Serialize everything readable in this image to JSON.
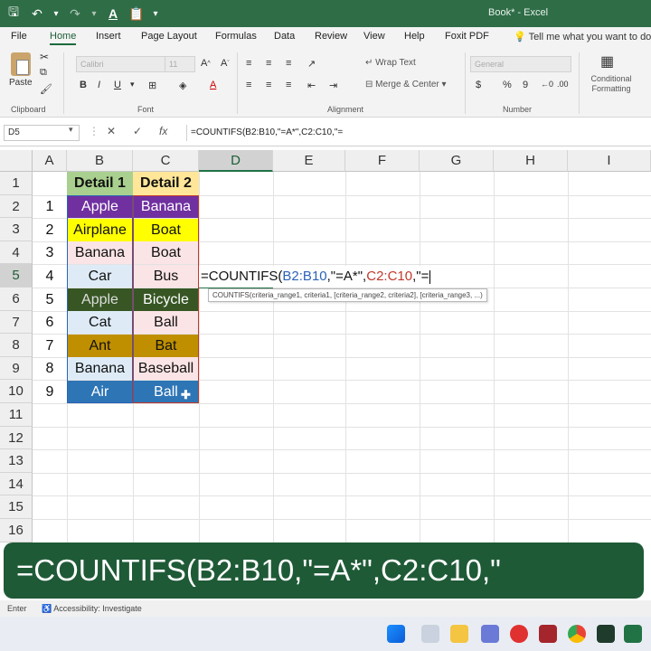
{
  "titlebar": {
    "title": "Book* - Excel"
  },
  "tabs": [
    "File",
    "Home",
    "Insert",
    "Page Layout",
    "Formulas",
    "Data",
    "Review",
    "View",
    "Help",
    "Foxit PDF"
  ],
  "tell_me": "Tell me what you want to do",
  "ribbon": {
    "paste": "Paste",
    "font_name": "Calibri",
    "font_size": "11",
    "wrap_text": "Wrap Text",
    "merge_center": "Merge & Center",
    "number_format": "General",
    "currency": "$",
    "percent": "%",
    "comma": "9",
    "conditional": "Conditional Formatting",
    "groups": {
      "clipboard": "Clipboard",
      "font": "Font",
      "alignment": "Alignment",
      "number": "Number"
    },
    "bold": "B",
    "italic": "I",
    "underline": "U"
  },
  "formula_bar": {
    "name_box": "D5",
    "cancel": "✕",
    "enter": "✓",
    "fx": "fx",
    "content": "=COUNTIFS(B2:B10,\"=A*\",C2:C10,\"="
  },
  "columns": [
    "A",
    "B",
    "C",
    "D",
    "E",
    "F",
    "G",
    "H",
    "I"
  ],
  "rows": [
    "1",
    "2",
    "3",
    "4",
    "5",
    "6",
    "7",
    "8",
    "9",
    "10",
    "11",
    "12",
    "13",
    "14",
    "15",
    "16"
  ],
  "headers": {
    "b1": "Detail 1",
    "c1": "Detail 2"
  },
  "table": [
    {
      "a": "1",
      "b": "Apple",
      "c": "Banana",
      "b_bg": "#7030a0",
      "b_fg": "#ffffff",
      "c_bg": "#7030a0",
      "c_fg": "#ffffff"
    },
    {
      "a": "2",
      "b": "Airplane",
      "c": "Boat",
      "b_bg": "#ffff00",
      "b_fg": "#111111",
      "c_bg": "#ffff00",
      "c_fg": "#111111"
    },
    {
      "a": "3",
      "b": "Banana",
      "c": "Boat",
      "b_bg": "#fbe4e6",
      "b_fg": "#111111",
      "c_bg": "#fbe4e6",
      "c_fg": "#111111"
    },
    {
      "a": "4",
      "b": "Car",
      "c": "Bus",
      "b_bg": "#deebf7",
      "b_fg": "#111111",
      "c_bg": "#fbe4e6",
      "c_fg": "#111111"
    },
    {
      "a": "5",
      "b": "Apple",
      "c": "Bicycle",
      "b_bg": "#375623",
      "b_fg": "#dddddd",
      "c_bg": "#375623",
      "c_fg": "#ffffff"
    },
    {
      "a": "6",
      "b": "Cat",
      "c": "Ball",
      "b_bg": "#deebf7",
      "b_fg": "#111111",
      "c_bg": "#fbe4e6",
      "c_fg": "#111111"
    },
    {
      "a": "7",
      "b": "Ant",
      "c": "Bat",
      "b_bg": "#bf8f00",
      "b_fg": "#111111",
      "c_bg": "#bf8f00",
      "c_fg": "#111111"
    },
    {
      "a": "8",
      "b": "Banana",
      "c": "Baseball",
      "b_bg": "#deebf7",
      "b_fg": "#111111",
      "c_bg": "#fbe4e6",
      "c_fg": "#111111"
    },
    {
      "a": "9",
      "b": "Air",
      "c": "Ball",
      "b_bg": "#2e75b6",
      "b_fg": "#ffffff",
      "c_bg": "#2e75b6",
      "c_fg": "#ffffff"
    }
  ],
  "colors": {
    "header_bg": "#a9d08e",
    "header2_bg": "#ffe699",
    "excel_green": "#217346",
    "banner_bg": "#1f5a37"
  },
  "formula_cell": {
    "prefix": "=COUNTIFS(",
    "range1": "B2:B10",
    "mid": ",\"=A*\",",
    "range2": "C2:C10",
    "suffix": ",\"="
  },
  "tooltip": "COUNTIFS(criteria_range1, criteria1, [criteria_range2, criteria2], [criteria_range3, ...)",
  "banner": "=COUNTIFS(B2:B10,\"=A*\",C2:C10,\"",
  "status": {
    "mode": "Enter",
    "accessibility": "Accessibility: Investigate"
  }
}
